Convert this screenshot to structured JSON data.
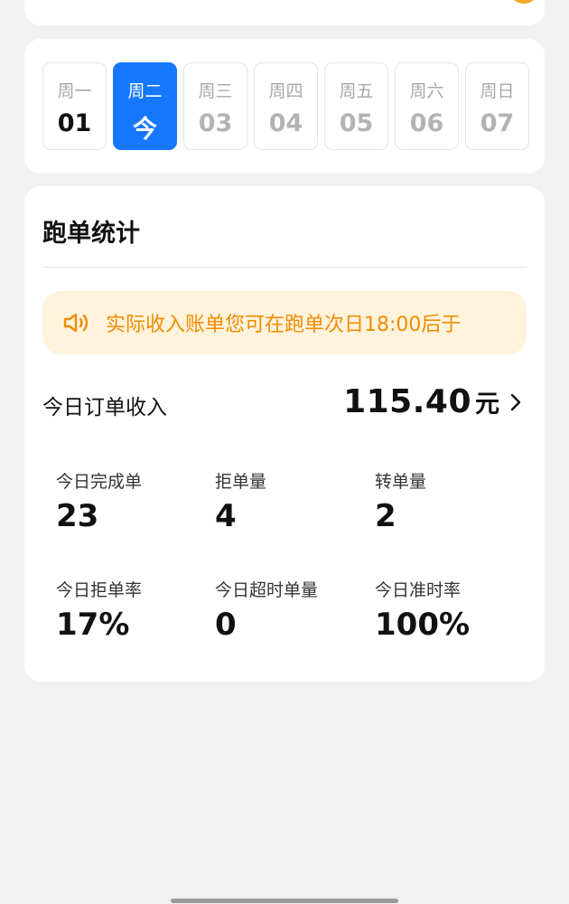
{
  "week": {
    "days": [
      {
        "weekday": "周一",
        "date": "01"
      },
      {
        "weekday": "周二",
        "date": "今"
      },
      {
        "weekday": "周三",
        "date": "03"
      },
      {
        "weekday": "周四",
        "date": "04"
      },
      {
        "weekday": "周五",
        "date": "05"
      },
      {
        "weekday": "周六",
        "date": "06"
      },
      {
        "weekday": "周日",
        "date": "07"
      }
    ],
    "selected_index": 1
  },
  "stats": {
    "title": "跑单统计",
    "notice": "实际收入账单您可在跑单次日18:00后于",
    "income_label": "今日订单收入",
    "income_amount": "115.40",
    "income_unit": "元",
    "metrics": [
      {
        "label": "今日完成单",
        "value": "23"
      },
      {
        "label": "拒单量",
        "value": "4"
      },
      {
        "label": "转单量",
        "value": "2"
      },
      {
        "label": "今日拒单率",
        "value": "17%"
      },
      {
        "label": "今日超时单量",
        "value": "0"
      },
      {
        "label": "今日准时率",
        "value": "100%"
      }
    ]
  },
  "colors": {
    "accent": "#1677ff",
    "notice_bg": "#fff3dc",
    "notice_text": "#f08c00",
    "background": "#f1f1f1"
  },
  "icons": {
    "notice": "speaker-icon",
    "income_arrow": "chevron-right-icon"
  }
}
